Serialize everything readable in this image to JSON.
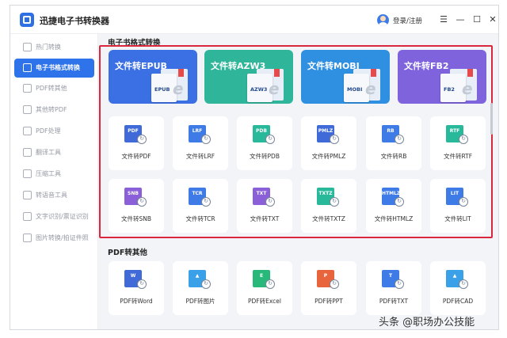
{
  "app": {
    "title": "迅捷电子书转换器",
    "login": "登录/注册"
  },
  "sidebar": {
    "items": [
      {
        "label": "热门转换",
        "active": false
      },
      {
        "label": "电子书格式转换",
        "active": true
      },
      {
        "label": "PDF转其他",
        "active": false
      },
      {
        "label": "其他转PDF",
        "active": false
      },
      {
        "label": "PDF处理",
        "active": false
      },
      {
        "label": "翻译工具",
        "active": false
      },
      {
        "label": "压缩工具",
        "active": false
      },
      {
        "label": "转语音工具",
        "active": false
      },
      {
        "label": "文字识别/票证识别",
        "active": false
      },
      {
        "label": "图片转换/拍证件照",
        "active": false
      }
    ]
  },
  "section1": {
    "title": "电子书格式转换",
    "big": [
      {
        "label": "文件转EPUB",
        "tag": "EPUB",
        "color": "#3b6fe4"
      },
      {
        "label": "文件转AZW3",
        "tag": "AZW3",
        "color": "#2fb59a"
      },
      {
        "label": "文件转MOBI",
        "tag": "MOBI",
        "color": "#2f8fe0"
      },
      {
        "label": "文件转FB2",
        "tag": "FB2",
        "color": "#7e63dd"
      }
    ],
    "row1": [
      {
        "tag": "PDF",
        "label": "文件转PDF",
        "color": "#3f6ad8"
      },
      {
        "tag": "LRF",
        "label": "文件转LRF",
        "color": "#3f7be6"
      },
      {
        "tag": "PDB",
        "label": "文件转PDB",
        "color": "#28b89a"
      },
      {
        "tag": "PMLZ",
        "label": "文件转PMLZ",
        "color": "#3f6ad8"
      },
      {
        "tag": "RB",
        "label": "文件转RB",
        "color": "#3f7be6"
      },
      {
        "tag": "RTF",
        "label": "文件转RTF",
        "color": "#28b89a"
      }
    ],
    "row2": [
      {
        "tag": "SNB",
        "label": "文件转SNB",
        "color": "#8a5fd8"
      },
      {
        "tag": "TCR",
        "label": "文件转TCR",
        "color": "#3f7be6"
      },
      {
        "tag": "TXT",
        "label": "文件转TXT",
        "color": "#8a5fd8"
      },
      {
        "tag": "TXTZ",
        "label": "文件转TXTZ",
        "color": "#28b89a"
      },
      {
        "tag": "HTMLZ",
        "label": "文件转HTMLZ",
        "color": "#3f7be6"
      },
      {
        "tag": "LIT",
        "label": "文件转LIT",
        "color": "#3f7be6"
      }
    ]
  },
  "section2": {
    "title": "PDF转其他",
    "items": [
      {
        "tag": "W",
        "label": "PDF转Word",
        "color": "#3f6ad8"
      },
      {
        "tag": "▲",
        "label": "PDF转图片",
        "color": "#3aa0e8"
      },
      {
        "tag": "E",
        "label": "PDF转Excel",
        "color": "#28b87a"
      },
      {
        "tag": "P",
        "label": "PDF转PPT",
        "color": "#e8643c"
      },
      {
        "tag": "T",
        "label": "PDF转TXT",
        "color": "#3f7be6"
      },
      {
        "tag": "▲",
        "label": "PDF转CAD",
        "color": "#3aa0e8"
      }
    ]
  },
  "watermark": "头条 @职场办公技能"
}
